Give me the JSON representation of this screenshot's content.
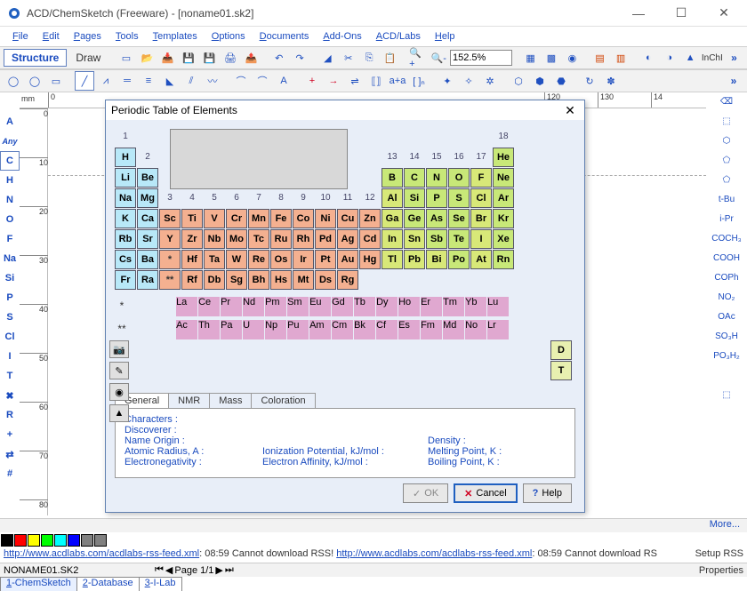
{
  "window": {
    "title": "ACD/ChemSketch (Freeware) - [noname01.sk2]",
    "min": "—",
    "max": "☐",
    "close": "✕"
  },
  "menus": [
    "File",
    "Edit",
    "Pages",
    "Tools",
    "Templates",
    "Options",
    "Documents",
    "Add-Ons",
    "ACD/Labs",
    "Help"
  ],
  "toolbar1": {
    "structure": "Structure",
    "draw": "Draw",
    "zoom": "152.5%",
    "inchi": "InChI"
  },
  "ruler": {
    "unit": "mm",
    "h": [
      "0",
      "120",
      "130",
      "14"
    ],
    "v": [
      "0",
      "10",
      "20",
      "30",
      "40",
      "50",
      "60",
      "70",
      "80"
    ]
  },
  "left_elements": [
    "",
    "A",
    "Any",
    "C",
    "H",
    "N",
    "O",
    "F",
    "Na",
    "Si",
    "P",
    "S",
    "Cl",
    "I",
    "T",
    "✖",
    "R",
    "+",
    "⇄",
    "#"
  ],
  "right_groups": [
    "⌫",
    "⬚",
    "⬡",
    "⬠",
    "⬠",
    "t-Bu",
    "i-Pr",
    "COCH₃",
    "COOH",
    "COPh",
    "NO₂",
    "OAc",
    "SO₃H",
    "PO₃H₂",
    "",
    "⬚"
  ],
  "colors": [
    "#000000",
    "#ff0000",
    "#ffff00",
    "#00ff00",
    "#00ffff",
    "#0000ff",
    "#808080",
    "#808080"
  ],
  "bottom": {
    "more": "More...",
    "rss_url": "http://www.acdlabs.com/acdlabs-rss-feed.xml",
    "rss_time": "08:59",
    "rss_msg": "Cannot download RSS!",
    "rss_msg2": "Cannot download RS",
    "setup": "Setup RSS",
    "filename": "NONAME01.SK2",
    "page": "Page 1/1",
    "props": "Properties",
    "tabs": [
      "1-ChemSketch",
      "2-Database",
      "3-I-Lab"
    ]
  },
  "dialog": {
    "title": "Periodic Table of Elements",
    "groups_top": [
      "1",
      "2",
      "3",
      "4",
      "5",
      "6",
      "7",
      "8",
      "9",
      "10",
      "11",
      "12",
      "13",
      "14",
      "15",
      "16",
      "17",
      "18"
    ],
    "rows": [
      [
        [
          "H",
          "c-blue"
        ],
        null,
        null,
        null,
        null,
        null,
        null,
        null,
        null,
        null,
        null,
        null,
        null,
        null,
        null,
        null,
        null,
        [
          "He",
          "c-noble"
        ]
      ],
      [
        [
          "Li",
          "c-blue"
        ],
        [
          "Be",
          "c-blue"
        ],
        null,
        null,
        null,
        null,
        null,
        null,
        null,
        null,
        null,
        null,
        [
          "B",
          "c-nonmetal"
        ],
        [
          "C",
          "c-nonmetal"
        ],
        [
          "N",
          "c-nonmetal"
        ],
        [
          "O",
          "c-nonmetal"
        ],
        [
          "F",
          "c-halogen"
        ],
        [
          "Ne",
          "c-noble"
        ]
      ],
      [
        [
          "Na",
          "c-blue"
        ],
        [
          "Mg",
          "c-blue"
        ],
        null,
        null,
        null,
        null,
        null,
        null,
        null,
        null,
        null,
        null,
        [
          "Al",
          "c-pt"
        ],
        [
          "Si",
          "c-metalloid"
        ],
        [
          "P",
          "c-nonmetal"
        ],
        [
          "S",
          "c-nonmetal"
        ],
        [
          "Cl",
          "c-halogen"
        ],
        [
          "Ar",
          "c-noble"
        ]
      ],
      [
        [
          "K",
          "c-blue"
        ],
        [
          "Ca",
          "c-blue"
        ],
        [
          "Sc",
          "c-tm"
        ],
        [
          "Ti",
          "c-tm"
        ],
        [
          "V",
          "c-tm"
        ],
        [
          "Cr",
          "c-tm"
        ],
        [
          "Mn",
          "c-tm"
        ],
        [
          "Fe",
          "c-tm"
        ],
        [
          "Co",
          "c-tm"
        ],
        [
          "Ni",
          "c-tm"
        ],
        [
          "Cu",
          "c-tm"
        ],
        [
          "Zn",
          "c-tm"
        ],
        [
          "Ga",
          "c-pt"
        ],
        [
          "Ge",
          "c-metalloid"
        ],
        [
          "As",
          "c-metalloid"
        ],
        [
          "Se",
          "c-nonmetal"
        ],
        [
          "Br",
          "c-halogen"
        ],
        [
          "Kr",
          "c-noble"
        ]
      ],
      [
        [
          "Rb",
          "c-blue"
        ],
        [
          "Sr",
          "c-blue"
        ],
        [
          "Y",
          "c-tm"
        ],
        [
          "Zr",
          "c-tm"
        ],
        [
          "Nb",
          "c-tm"
        ],
        [
          "Mo",
          "c-tm"
        ],
        [
          "Tc",
          "c-tm"
        ],
        [
          "Ru",
          "c-tm"
        ],
        [
          "Rh",
          "c-tm"
        ],
        [
          "Pd",
          "c-tm"
        ],
        [
          "Ag",
          "c-tm"
        ],
        [
          "Cd",
          "c-tm"
        ],
        [
          "In",
          "c-pt"
        ],
        [
          "Sn",
          "c-pt"
        ],
        [
          "Sb",
          "c-metalloid"
        ],
        [
          "Te",
          "c-metalloid"
        ],
        [
          "I",
          "c-halogen"
        ],
        [
          "Xe",
          "c-noble"
        ]
      ],
      [
        [
          "Cs",
          "c-blue"
        ],
        [
          "Ba",
          "c-blue"
        ],
        [
          "*",
          "c-star"
        ],
        [
          "Hf",
          "c-tm"
        ],
        [
          "Ta",
          "c-tm"
        ],
        [
          "W",
          "c-tm"
        ],
        [
          "Re",
          "c-tm"
        ],
        [
          "Os",
          "c-tm"
        ],
        [
          "Ir",
          "c-tm"
        ],
        [
          "Pt",
          "c-tm"
        ],
        [
          "Au",
          "c-tm"
        ],
        [
          "Hg",
          "c-tm"
        ],
        [
          "Tl",
          "c-pt"
        ],
        [
          "Pb",
          "c-pt"
        ],
        [
          "Bi",
          "c-pt"
        ],
        [
          "Po",
          "c-metalloid"
        ],
        [
          "At",
          "c-halogen"
        ],
        [
          "Rn",
          "c-noble"
        ]
      ],
      [
        [
          "Fr",
          "c-blue"
        ],
        [
          "Ra",
          "c-blue"
        ],
        [
          "**",
          "c-star"
        ],
        [
          "Rf",
          "c-tm"
        ],
        [
          "Db",
          "c-tm"
        ],
        [
          "Sg",
          "c-tm"
        ],
        [
          "Bh",
          "c-tm"
        ],
        [
          "Hs",
          "c-tm"
        ],
        [
          "Mt",
          "c-tm"
        ],
        [
          "Ds",
          "c-tm"
        ],
        [
          "Rg",
          "c-tm"
        ],
        null,
        null,
        null,
        null,
        null,
        null,
        null
      ]
    ],
    "lanthanides": [
      "La",
      "Ce",
      "Pr",
      "Nd",
      "Pm",
      "Sm",
      "Eu",
      "Gd",
      "Tb",
      "Dy",
      "Ho",
      "Er",
      "Tm",
      "Yb",
      "Lu"
    ],
    "actinides": [
      "Ac",
      "Th",
      "Pa",
      "U",
      "Np",
      "Pu",
      "Am",
      "Cm",
      "Bk",
      "Cf",
      "Es",
      "Fm",
      "Md",
      "No",
      "Lr"
    ],
    "star1": "*",
    "star2": "**",
    "dt": [
      "D",
      "T"
    ],
    "side": [
      "📷",
      "✎",
      "◉",
      "▲"
    ],
    "tabs": [
      "General",
      "NMR",
      "Mass",
      "Coloration"
    ],
    "general": {
      "characters": "Characters :",
      "discoverer": "Discoverer :",
      "origin": "Name Origin :",
      "radius": "Atomic Radius, A :",
      "eneg": "Electronegativity :",
      "ion": "Ionization Potential, kJ/mol :",
      "aff": "Electron Affinity, kJ/mol :",
      "density": "Density :",
      "melt": "Melting Point, K :",
      "boil": "Boiling Point, K :"
    },
    "buttons": {
      "ok": "OK",
      "cancel": "Cancel",
      "help": "Help"
    }
  }
}
